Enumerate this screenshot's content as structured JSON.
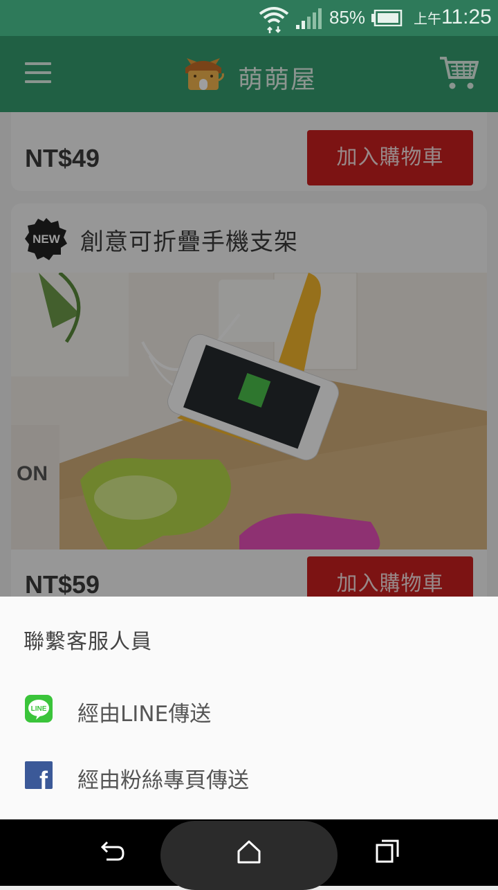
{
  "status_bar": {
    "battery_percent": "85%",
    "time_period": "上午",
    "time": "11:25"
  },
  "app_bar": {
    "title": "萌萌屋"
  },
  "products": [
    {
      "price": "NT$49",
      "add_button": "加入購物車"
    },
    {
      "badge": "NEW",
      "title": "創意可折疊手機支架",
      "price": "NT$59",
      "add_button": "加入購物車"
    }
  ],
  "sheet": {
    "heading": "聯繫客服人員",
    "options": [
      {
        "label": "經由LINE傳送",
        "icon": "line-icon",
        "icon_text": "LINE",
        "color": "#3ac43a"
      },
      {
        "label": "經由粉絲專頁傳送",
        "icon": "facebook-icon",
        "icon_text": "f",
        "color": "#3b5998"
      }
    ]
  },
  "colors": {
    "status_bar": "#2e7a5a",
    "app_bar": "#349c6e",
    "add_button": "#c81f1f"
  }
}
